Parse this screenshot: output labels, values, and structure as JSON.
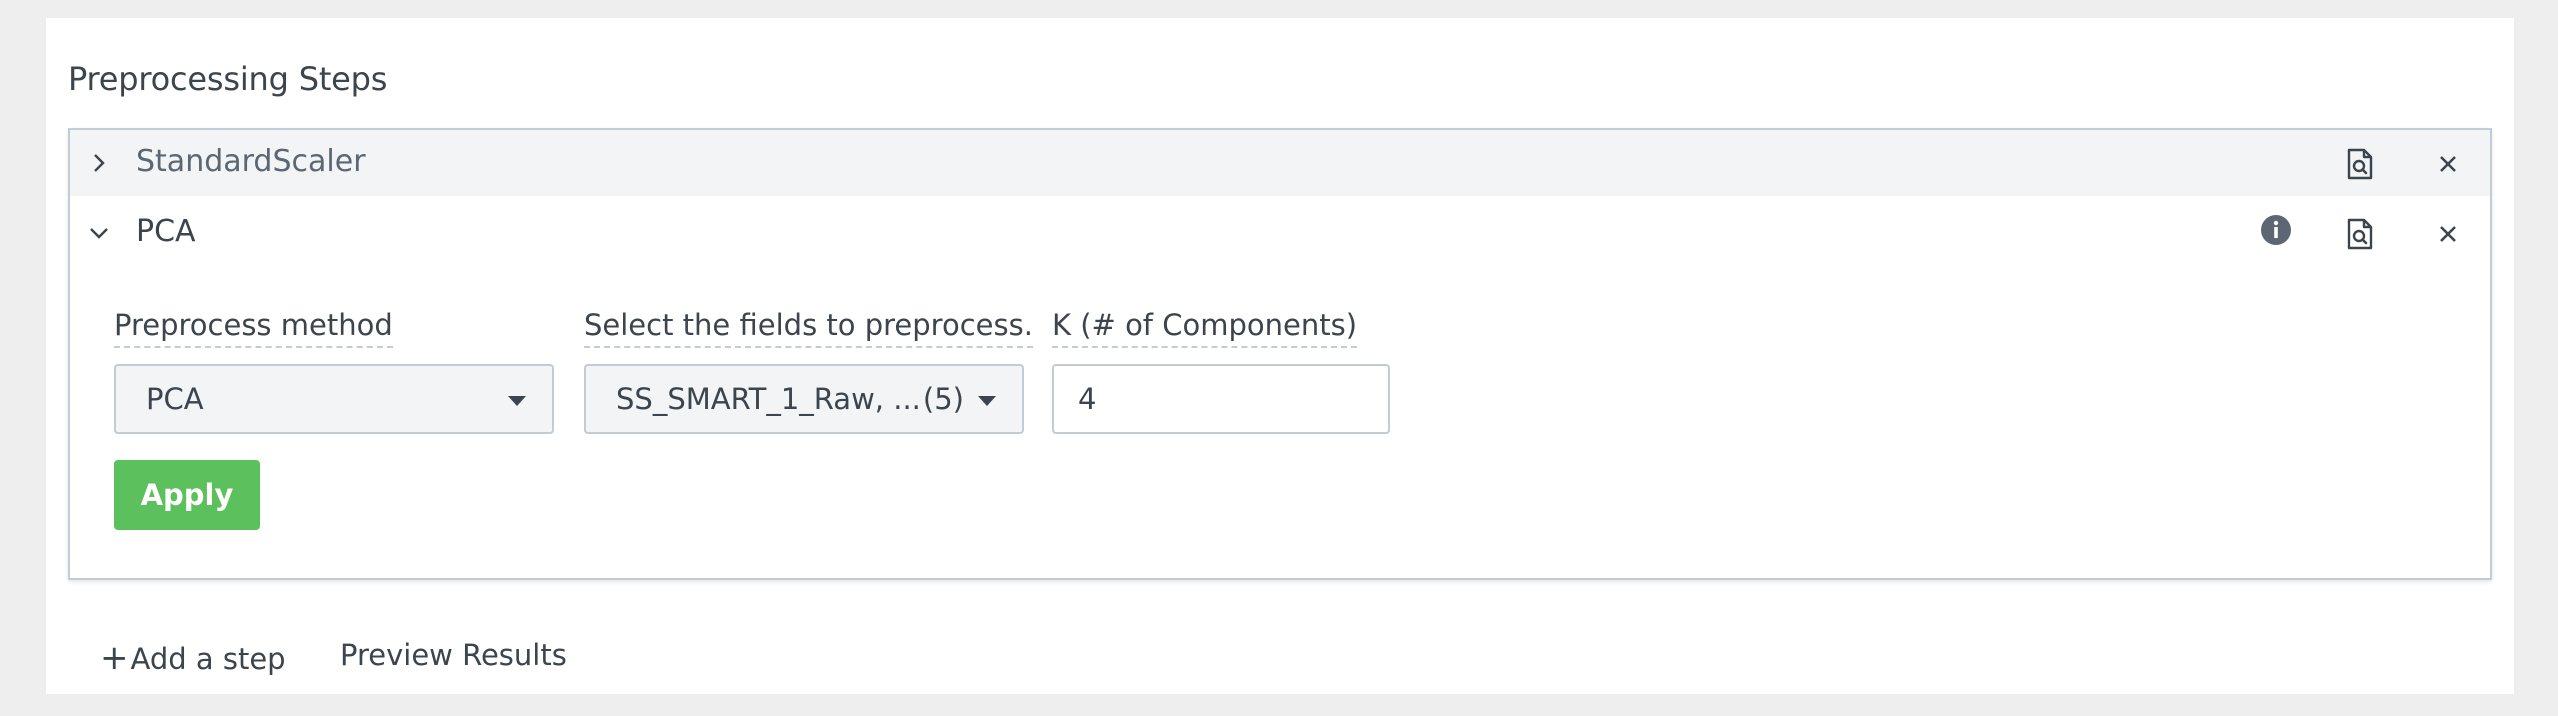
{
  "section": {
    "title": "Preprocessing Steps"
  },
  "steps": [
    {
      "name": "StandardScaler",
      "expanded": false,
      "icons": [
        "chevron-right-icon",
        "preview-icon",
        "close-icon"
      ]
    },
    {
      "name": "PCA",
      "expanded": true,
      "icons": [
        "chevron-down-icon",
        "info-icon",
        "preview-icon",
        "close-icon"
      ],
      "form": {
        "method_label": "Preprocess method",
        "method_value": "PCA",
        "fields_label": "Select the fields to preprocess.",
        "fields_value": "SS_SMART_1_Raw, ...",
        "fields_count": "(5)",
        "k_label": "K (# of Components)",
        "k_value": "4",
        "apply_label": "Apply"
      }
    }
  ],
  "footer": {
    "add_step_label": "Add a step",
    "preview_results_label": "Preview Results"
  },
  "colors": {
    "apply": "#5cc05c",
    "text": "#3c444d",
    "border": "#c3cbd4",
    "row_bg": "#f2f4f5"
  }
}
